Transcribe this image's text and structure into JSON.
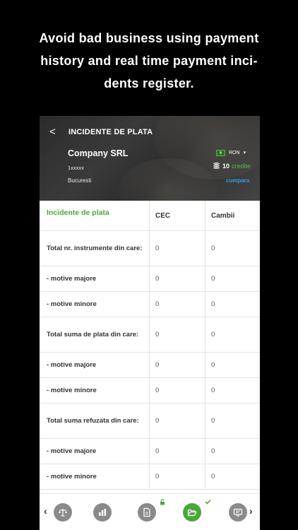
{
  "promo": {
    "line1": "Avoid bad business using payment",
    "line2": "history and real time payment inci-",
    "line3": "dents register."
  },
  "header": {
    "back_symbol": "<",
    "title": "INCIDENTE DE PLATA"
  },
  "company": {
    "name": "Company SRL",
    "id": "1xxxxx",
    "city": "Bucuresti"
  },
  "account": {
    "currency": "RON",
    "credits_count": "10",
    "credits_label": "credite",
    "buy_label": "cumpara"
  },
  "table": {
    "headers": [
      "Incidente de plata",
      "CEC",
      "Cambii"
    ],
    "rows": [
      {
        "label": "Total nr. instrumente din care:",
        "cec": "0",
        "cambii": "0"
      },
      {
        "label": "- motive majore",
        "cec": "0",
        "cambii": "0"
      },
      {
        "label": "- motive minore",
        "cec": "0",
        "cambii": "0"
      },
      {
        "label": "Total suma de plata din care:",
        "cec": "0",
        "cambii": "0"
      },
      {
        "label": "- motive majore",
        "cec": "0",
        "cambii": "0"
      },
      {
        "label": "- motive minore",
        "cec": "0",
        "cambii": "0"
      },
      {
        "label": "Total suma refuzata din care:",
        "cec": "0",
        "cambii": "0"
      },
      {
        "label": "- motive majore",
        "cec": "0",
        "cambii": "0"
      },
      {
        "label": "- motive minore",
        "cec": "0",
        "cambii": "0"
      }
    ]
  },
  "bottom_nav": {
    "prev_symbol": "‹",
    "next_symbol": "›",
    "items": [
      {
        "icon": "scales-icon",
        "active": false
      },
      {
        "icon": "bar-chart-icon",
        "active": false
      },
      {
        "icon": "document-icon",
        "active": false,
        "badge": "lock-icon"
      },
      {
        "icon": "folder-open-icon",
        "active": true,
        "badge": "checkmark-icon"
      },
      {
        "icon": "monitor-icon",
        "active": false
      }
    ]
  },
  "colors": {
    "accent_green": "#4aa83a",
    "link_blue": "#2e9fd8",
    "inactive_gray": "#8a8a8a"
  }
}
